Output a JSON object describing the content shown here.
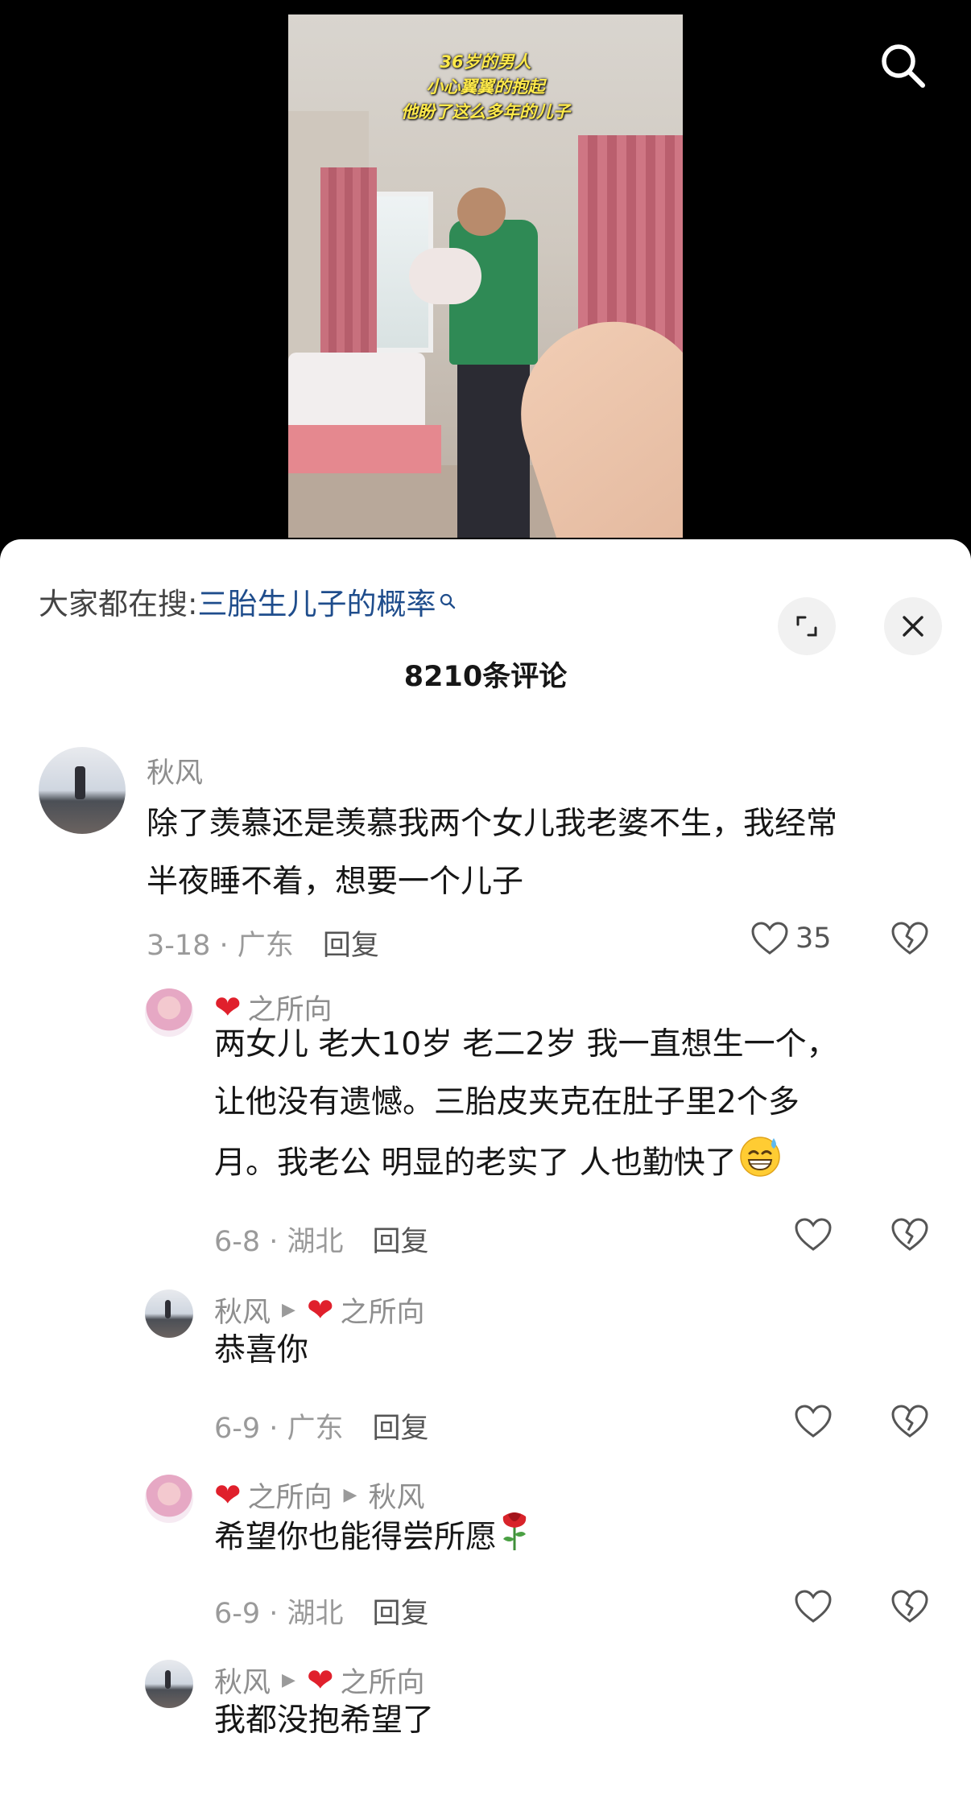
{
  "video": {
    "caption_lines": [
      "36岁的男人",
      "小心翼翼的抱起",
      "他盼了这么多年的儿子"
    ]
  },
  "sheet": {
    "hot_search_prefix": "大家都在搜:",
    "hot_search_keyword": "三胎生儿子的概率",
    "comment_count": "8210条评论"
  },
  "comments": [
    {
      "author": "秋风",
      "text": [
        "除了羡慕还是羡慕我两个女儿我老婆不生，我经常",
        "半夜睡不着，想要一个儿子"
      ],
      "date_loc": "3-18 · 广东",
      "reply_label": "回复",
      "likes": "35"
    }
  ],
  "replies": [
    {
      "author": "之所向",
      "text": [
        "两女儿 老大10岁 老二2岁 我一直想生一个，",
        "让他没有遗憾。三胎皮夹克在肚子里2个多",
        "月。我老公 明显的老实了 人也勤快了"
      ],
      "date_loc": "6-8 · 湖北",
      "reply_label": "回复"
    },
    {
      "author": "秋风",
      "reply_to": "之所向",
      "text": [
        "恭喜你"
      ],
      "date_loc": "6-9 · 广东",
      "reply_label": "回复"
    },
    {
      "author": "之所向",
      "reply_to": "秋风",
      "text": [
        "希望你也能得尝所愿"
      ],
      "date_loc": "6-9 · 湖北",
      "reply_label": "回复"
    },
    {
      "author": "秋风",
      "reply_to": "之所向",
      "text": [
        "我都没抱希望了"
      ]
    }
  ],
  "icons": {
    "search": "search-icon",
    "expand": "expand-icon",
    "close": "close-icon",
    "like": "heart-outline-icon",
    "dislike": "broken-heart-icon",
    "heart_emoji": "red-heart-emoji",
    "sweat_emoji": "grinning-sweat-emoji",
    "rose_emoji": "rose-emoji"
  },
  "colors": {
    "keyword_link": "#1f4d8c",
    "caption": "#fde94a",
    "heart_emoji": "#e0202c"
  }
}
